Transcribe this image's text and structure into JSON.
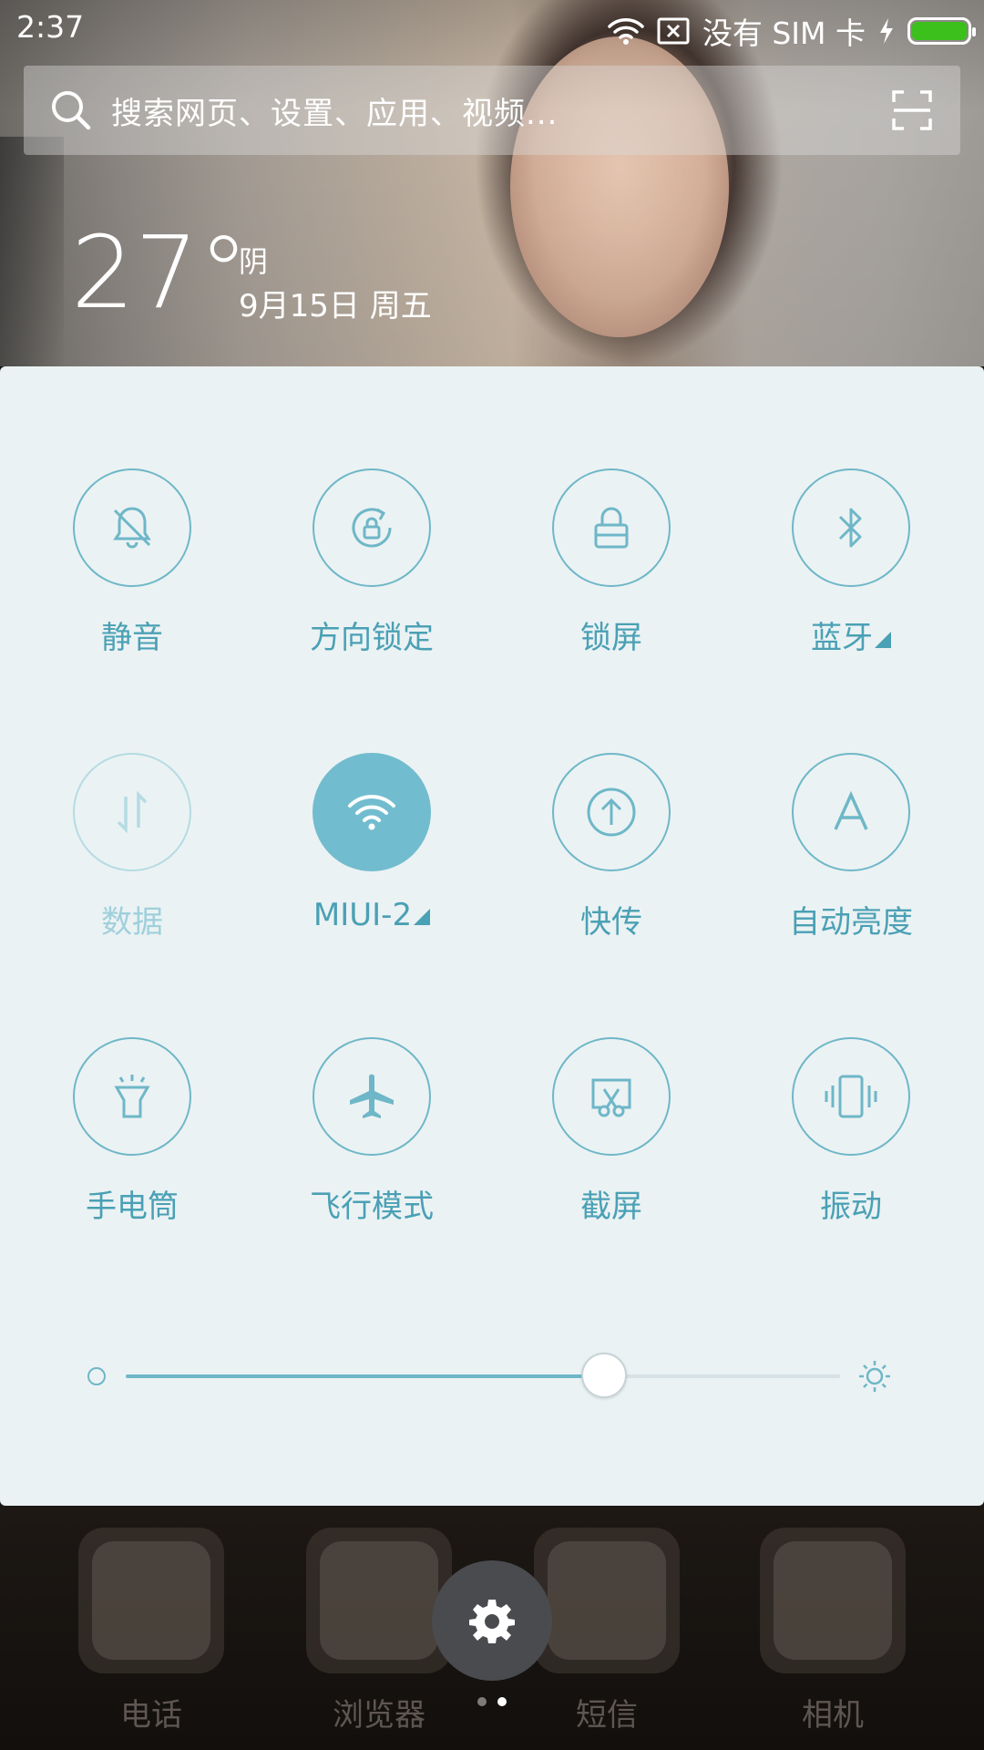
{
  "status_bar": {
    "time": "2:37",
    "carrier": "没有 SIM 卡",
    "battery_level": 1.0,
    "battery_color": "#3cc01c"
  },
  "search": {
    "placeholder": "搜索网页、设置、应用、视频..."
  },
  "weather": {
    "temperature": "27°",
    "condition": "阴",
    "date": "9月15日 周五"
  },
  "quick_settings": {
    "accent_color": "#6eb7c8",
    "tiles": [
      {
        "label": "静音",
        "icon": "bell-off-icon",
        "state": "off"
      },
      {
        "label": "方向锁定",
        "icon": "rotation-lock-icon",
        "state": "off"
      },
      {
        "label": "锁屏",
        "icon": "lock-icon",
        "state": "off"
      },
      {
        "label": "蓝牙",
        "icon": "bluetooth-icon",
        "state": "off",
        "expandable": true
      },
      {
        "label": "数据",
        "icon": "mobile-data-icon",
        "state": "disabled"
      },
      {
        "label": "MIUI-2",
        "icon": "wifi-icon",
        "state": "on",
        "expandable": true
      },
      {
        "label": "快传",
        "icon": "quick-transfer-icon",
        "state": "off"
      },
      {
        "label": "自动亮度",
        "icon": "auto-brightness-icon",
        "state": "off"
      },
      {
        "label": "手电筒",
        "icon": "flashlight-icon",
        "state": "off"
      },
      {
        "label": "飞行模式",
        "icon": "airplane-icon",
        "state": "off"
      },
      {
        "label": "截屏",
        "icon": "screenshot-icon",
        "state": "off"
      },
      {
        "label": "振动",
        "icon": "vibrate-icon",
        "state": "off"
      }
    ],
    "brightness_level": 0.67
  },
  "home_screen": {
    "apps": [
      {
        "label": "电话",
        "icon": "phone-icon"
      },
      {
        "label": "浏览器",
        "icon": "browser-icon"
      },
      {
        "label": "短信",
        "icon": "messages-icon"
      },
      {
        "label": "相机",
        "icon": "camera-icon"
      }
    ],
    "settings_icon": "gear-icon",
    "page_count": 2,
    "current_page": 2
  }
}
